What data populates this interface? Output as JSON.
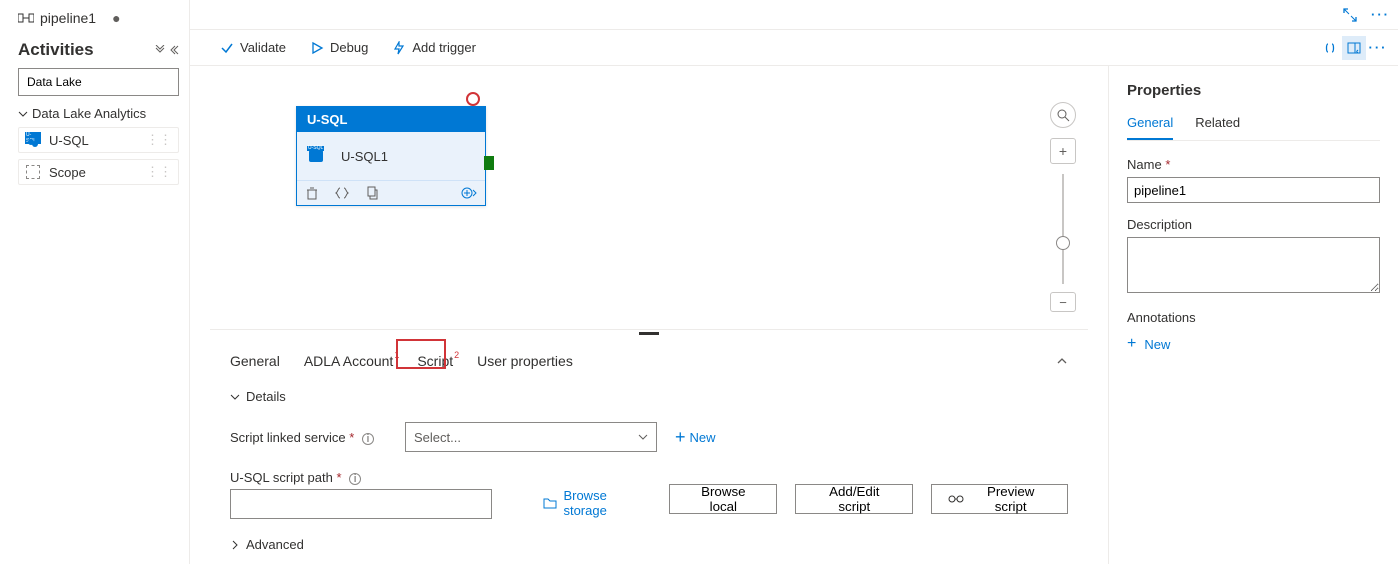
{
  "tab": {
    "name": "pipeline1"
  },
  "sidebar": {
    "title": "Activities",
    "searchPlaceholder": "Data Lake",
    "category": "Data Lake Analytics",
    "items": [
      "U-SQL",
      "Scope"
    ]
  },
  "toolbar": {
    "validate": "Validate",
    "debug": "Debug",
    "addTrigger": "Add trigger"
  },
  "activity": {
    "type": "U-SQL",
    "name": "U-SQL1"
  },
  "bottomTabs": {
    "general": "General",
    "adla": "ADLA Account",
    "script": "Script",
    "user": "User properties",
    "badge1": "1",
    "badge2": "2"
  },
  "details": {
    "heading": "Details",
    "scriptLinked": "Script linked service",
    "selectPh": "Select...",
    "new": "New",
    "scriptPath": "U-SQL script path",
    "browseStorage": "Browse storage",
    "browseLocal": "Browse local",
    "addEdit": "Add/Edit script",
    "preview": "Preview script",
    "advanced": "Advanced"
  },
  "props": {
    "title": "Properties",
    "tabGeneral": "General",
    "tabRelated": "Related",
    "nameLbl": "Name",
    "nameVal": "pipeline1",
    "descLbl": "Description",
    "annLbl": "Annotations",
    "new": "New"
  }
}
